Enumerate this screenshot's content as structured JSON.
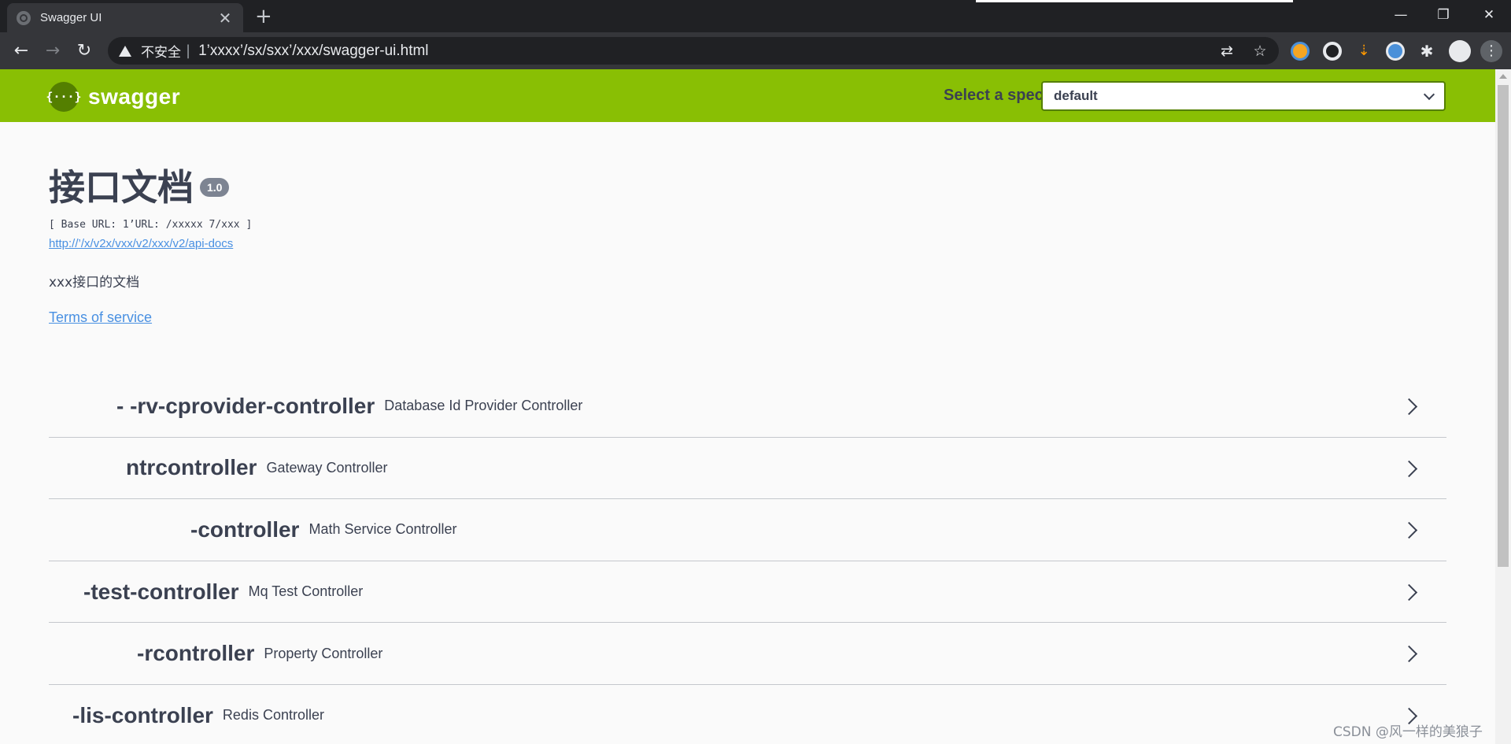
{
  "browser": {
    "tab_title": "Swagger UI",
    "tab_close": "✕",
    "new_tab": "+",
    "insecure_label": "不安全",
    "separator": "|",
    "url": "1’xxxx’/sx/sxx’/xxx/swagger-ui.html",
    "window_controls": {
      "minimize": "—",
      "maximize": "❐",
      "close": "✕"
    },
    "nav": {
      "back": "←",
      "forward": "→",
      "reload": "↻"
    }
  },
  "topbar": {
    "logo_symbol": "{···}",
    "logo_text": "swagger",
    "spec_label": "Select a spec",
    "spec_value": "default"
  },
  "info": {
    "title": "接口文档",
    "version": "1.0",
    "base_url": "[ Base URL: 1’URL: /xxxxx 7/xxx ]",
    "docs_url": "http://’/x/v2x/vxx/v2/xxx/v2/api-docs",
    "description": "xxx接口的文档",
    "terms_label": "Terms of service"
  },
  "controllers": [
    {
      "name": "- -rv-cprovider-controller",
      "description": "Database Id Provider Controller"
    },
    {
      "name": "ntrcontroller",
      "description": "Gateway Controller"
    },
    {
      "name": "-controller",
      "description": "Math Service Controller"
    },
    {
      "name": "-test-controller",
      "description": "Mq Test Controller"
    },
    {
      "name": "-rcontroller",
      "description": "Property Controller"
    },
    {
      "name": "-lis-controller",
      "description": "Redis Controller"
    }
  ],
  "watermark": "CSDN @风一样的美狼子",
  "colors": {
    "topbar": "#89bf04",
    "topbar_dark": "#547f00",
    "text": "#3b4151",
    "link": "#4990e2",
    "badge": "#7d8492"
  }
}
